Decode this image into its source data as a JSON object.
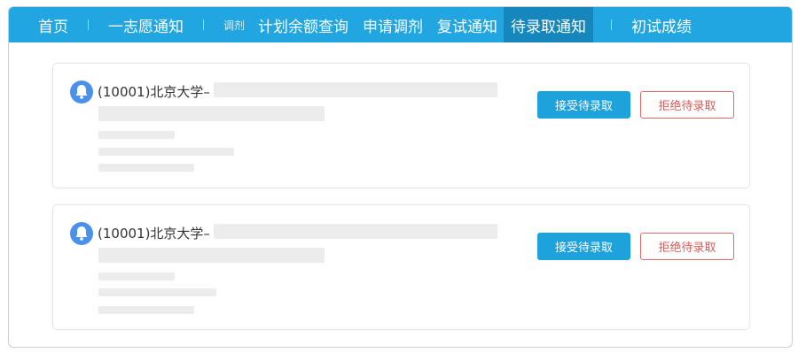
{
  "nav": {
    "items": [
      {
        "label": "首页"
      },
      {
        "label": "一志愿通知"
      },
      {
        "label": "调剂"
      },
      {
        "label": "计划余额查询"
      },
      {
        "label": "申请调剂"
      },
      {
        "label": "复试通知"
      },
      {
        "label": "待录取通知"
      },
      {
        "label": "初试成绩"
      }
    ],
    "active_label": "待录取通知"
  },
  "cards": [
    {
      "school": "(10001)北京大学–",
      "accept_label": "接受待录取",
      "reject_label": "拒绝待录取"
    },
    {
      "school": "(10001)北京大学–",
      "accept_label": "接受待录取",
      "reject_label": "拒绝待录取"
    }
  ],
  "colors": {
    "nav_bg": "#21a6e2",
    "nav_active": "#1687bd",
    "accept_bg": "#1ea2dc",
    "reject_border": "#e46a6a",
    "bell": "#4b90ea"
  },
  "icons": {
    "card_icon": "bell-icon"
  }
}
